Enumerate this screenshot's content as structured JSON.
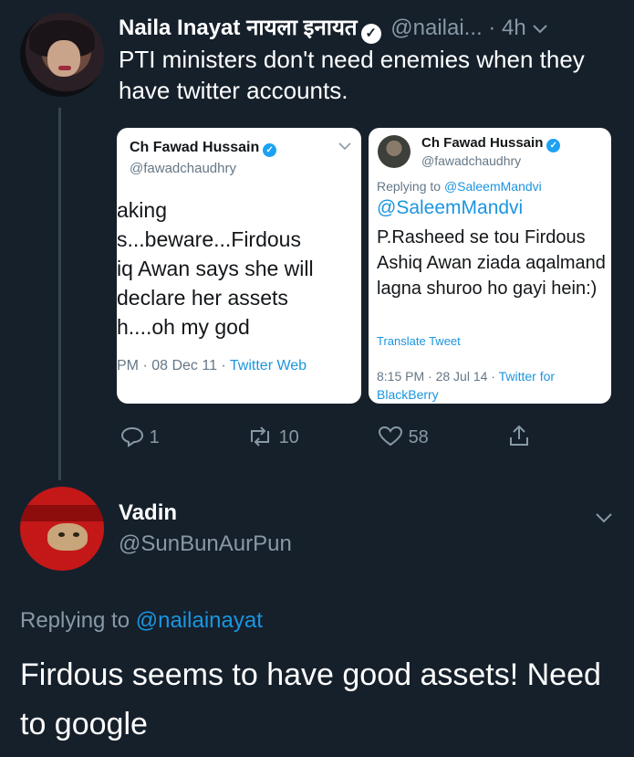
{
  "tweet1": {
    "author_name": "Naila Inayat नायला इनायत",
    "handle": "@nailai...",
    "separator": "·",
    "time": "4h",
    "text": "PTI ministers don't need enemies when they have twitter accounts."
  },
  "embed_left": {
    "name": "Ch Fawad Hussain",
    "handle": "@fawadchaudhry",
    "lines": [
      "aking",
      "s...beware...Firdous",
      "iq Awan says she will",
      " declare her assets",
      "h....oh my god"
    ],
    "meta_prefix": "PM · 08 Dec 11 · ",
    "meta_source": "Twitter Web"
  },
  "embed_right": {
    "name": "Ch Fawad Hussain",
    "handle": "@fawadchaudhry",
    "replying_prefix": "Replying to ",
    "replying_handle": "@SaleemMandvi",
    "mention": "@SaleemMandvi",
    "text": "P.Rasheed se tou Firdous Ashiq Awan ziada aqalmand lagna shuroo ho gayi hein:)",
    "translate": "Translate Tweet",
    "meta_prefix": "8:15 PM · 28 Jul 14 · ",
    "meta_source": "Twitter for BlackBerry"
  },
  "actions": {
    "replies": "1",
    "retweets": "10",
    "likes": "58"
  },
  "tweet2": {
    "author_name": "Vadin",
    "handle": "@SunBunAurPun",
    "replying_prefix": "Replying to ",
    "replying_handle": "@nailainayat",
    "text": "Firdous seems to have good assets! Need to google"
  },
  "icons": {
    "verified": "verified-badge-icon",
    "chevron": "chevron-down-icon",
    "reply": "reply-icon",
    "retweet": "retweet-icon",
    "like": "heart-icon",
    "share": "share-icon"
  },
  "colors": {
    "background": "#15202b",
    "secondary_text": "#8899a6",
    "link": "#1b95e0",
    "thread_line": "#38444d"
  }
}
